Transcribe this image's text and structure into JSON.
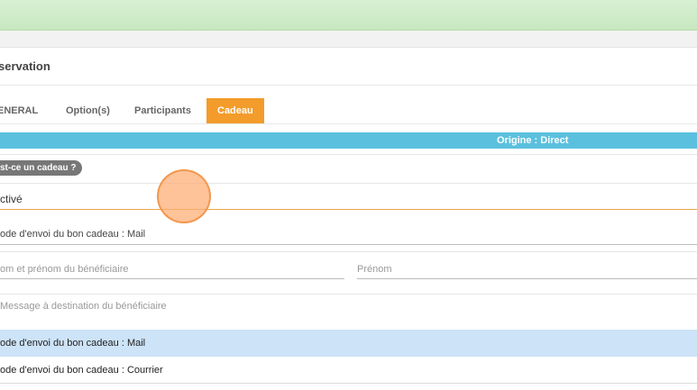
{
  "header": {
    "title": "servation"
  },
  "tabs": [
    {
      "label": "ENERAL"
    },
    {
      "label": "Option(s)"
    },
    {
      "label": "Participants"
    },
    {
      "label": "Cadeau",
      "active": true
    }
  ],
  "origin": {
    "text": "Origine : Direct",
    "color": "#5bc0de"
  },
  "gift": {
    "question_badge": "st-ce un cadeau ?",
    "select_value": "ctivé",
    "send_mode_text": "ode d'envoi du bon cadeau : Mail",
    "beneficiary_name_placeholder": "om et prénom du bénéficiaire",
    "beneficiary_firstname_placeholder": "Prénom",
    "message_placeholder": "Message à destination du bénéficiaire"
  },
  "dropdown_options": [
    {
      "label": "ode d'envoi du bon cadeau : Mail",
      "selected": true
    },
    {
      "label": "ode d'envoi du bon cadeau : Courrier",
      "selected": false
    }
  ],
  "colors": {
    "accent": "#f39c2b",
    "topbar": "#cfeccb",
    "selected_option": "#cde3f7"
  }
}
